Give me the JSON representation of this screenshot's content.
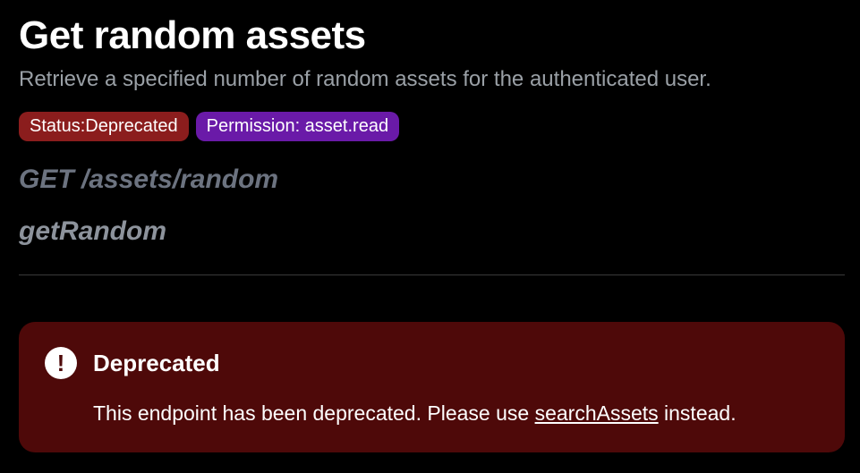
{
  "header": {
    "title": "Get random assets",
    "subtitle": "Retrieve a specified number of random assets for the authenticated user."
  },
  "badges": {
    "status": "Status:Deprecated",
    "permission": "Permission: asset.read"
  },
  "endpoint": {
    "method_path": "GET /assets/random",
    "operation_id": "getRandom"
  },
  "alert": {
    "icon": "exclamation-circle-icon",
    "title": "Deprecated",
    "message_before": "This endpoint has been deprecated. Please use ",
    "link_text": "searchAssets",
    "message_after": " instead."
  },
  "colors": {
    "background": "#000000",
    "status_badge": "#8b1d1d",
    "permission_badge": "#6a1aa8",
    "alert_background": "#4e0909"
  }
}
